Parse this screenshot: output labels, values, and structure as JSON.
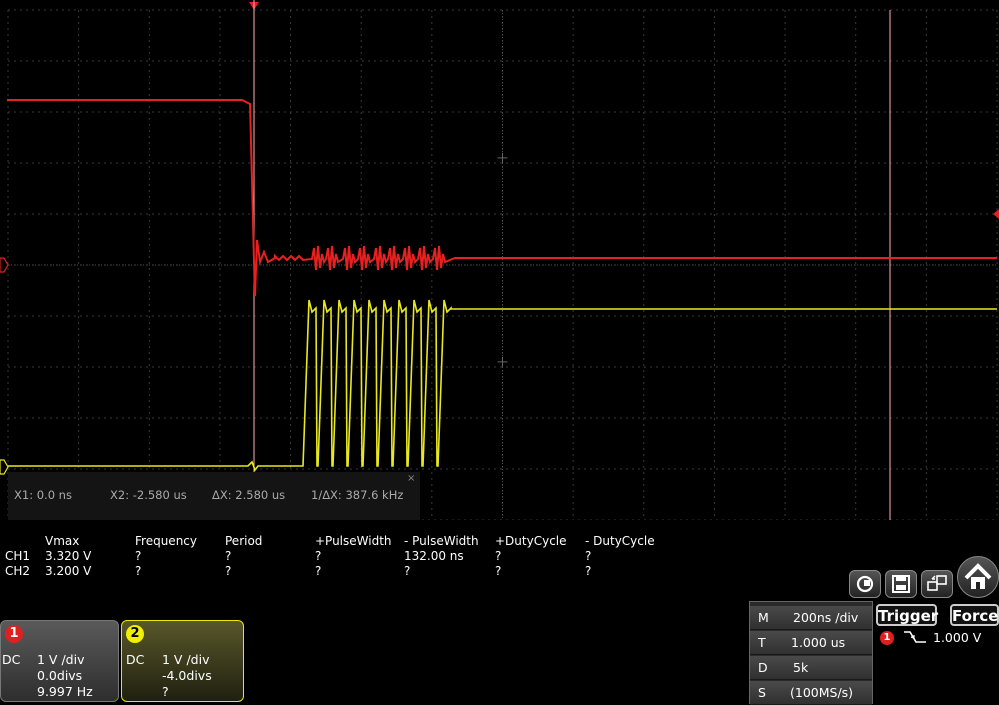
{
  "cursors": {
    "x1": "X1: 0.0 ns",
    "x2": "X2: -2.580 us",
    "dx": "ΔX: 2.580 us",
    "inv_dx": "1/ΔX: 387.6 kHz",
    "close": "×"
  },
  "measurements": {
    "headers": [
      "Vmax",
      "Frequency",
      "Period",
      "+PulseWidth",
      "- PulseWidth",
      "+DutyCycle",
      "- DutyCycle"
    ],
    "rows": [
      {
        "label": "CH1",
        "values": [
          "3.320 V",
          "?",
          "?",
          "?",
          "132.00 ns",
          "?",
          "?"
        ]
      },
      {
        "label": "CH2",
        "values": [
          "3.200 V",
          "?",
          "?",
          "?",
          "?",
          "?",
          "?"
        ]
      }
    ]
  },
  "channel1": {
    "number": "1",
    "coupling": "DC",
    "scale": "1 V /div",
    "offset": "0.0divs",
    "frequency": "9.997 Hz",
    "color": "#e02020"
  },
  "channel2": {
    "number": "2",
    "coupling": "DC",
    "scale": "1 V /div",
    "offset": "-4.0divs",
    "frequency": "?",
    "color": "#f0f000"
  },
  "horizontal": {
    "m_label": "M",
    "m_value": "200ns /div",
    "t_label": "T",
    "t_value": "1.000 us",
    "d_label": "D",
    "d_value": "5k",
    "s_label": "S",
    "s_value": "(100MS/s)"
  },
  "trigger": {
    "label": "Trigger",
    "force_label": "Force",
    "source": "1",
    "level": "1.000 V"
  },
  "icons": [
    "refresh-icon",
    "save-icon",
    "window-icon",
    "home-icon"
  ]
}
